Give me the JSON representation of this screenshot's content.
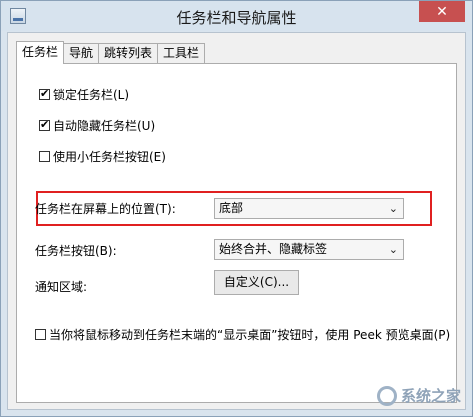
{
  "window": {
    "title": "任务栏和导航属性",
    "close_label": "✕"
  },
  "tabs": [
    {
      "label": "任务栏",
      "active": true
    },
    {
      "label": "导航",
      "active": false
    },
    {
      "label": "跳转列表",
      "active": false
    },
    {
      "label": "工具栏",
      "active": false
    }
  ],
  "options": {
    "lock_taskbar": {
      "label": "锁定任务栏(L)",
      "checked": true
    },
    "auto_hide": {
      "label": "自动隐藏任务栏(U)",
      "checked": true
    },
    "small_buttons": {
      "label": "使用小任务栏按钮(E)",
      "checked": false
    },
    "peek": {
      "label": "当你将鼠标移动到任务栏末端的“显示桌面”按钮时，使用 Peek 预览桌面(P)",
      "checked": false
    }
  },
  "position": {
    "label": "任务栏在屏幕上的位置(T):",
    "value": "底部"
  },
  "buttons_setting": {
    "label": "任务栏按钮(B):",
    "value": "始终合并、隐藏标签"
  },
  "notification": {
    "label": "通知区域:",
    "button": "自定义(C)..."
  },
  "watermark": {
    "text": "系统之家"
  },
  "colors": {
    "highlight": "#e02020",
    "close_button": "#c75050"
  }
}
